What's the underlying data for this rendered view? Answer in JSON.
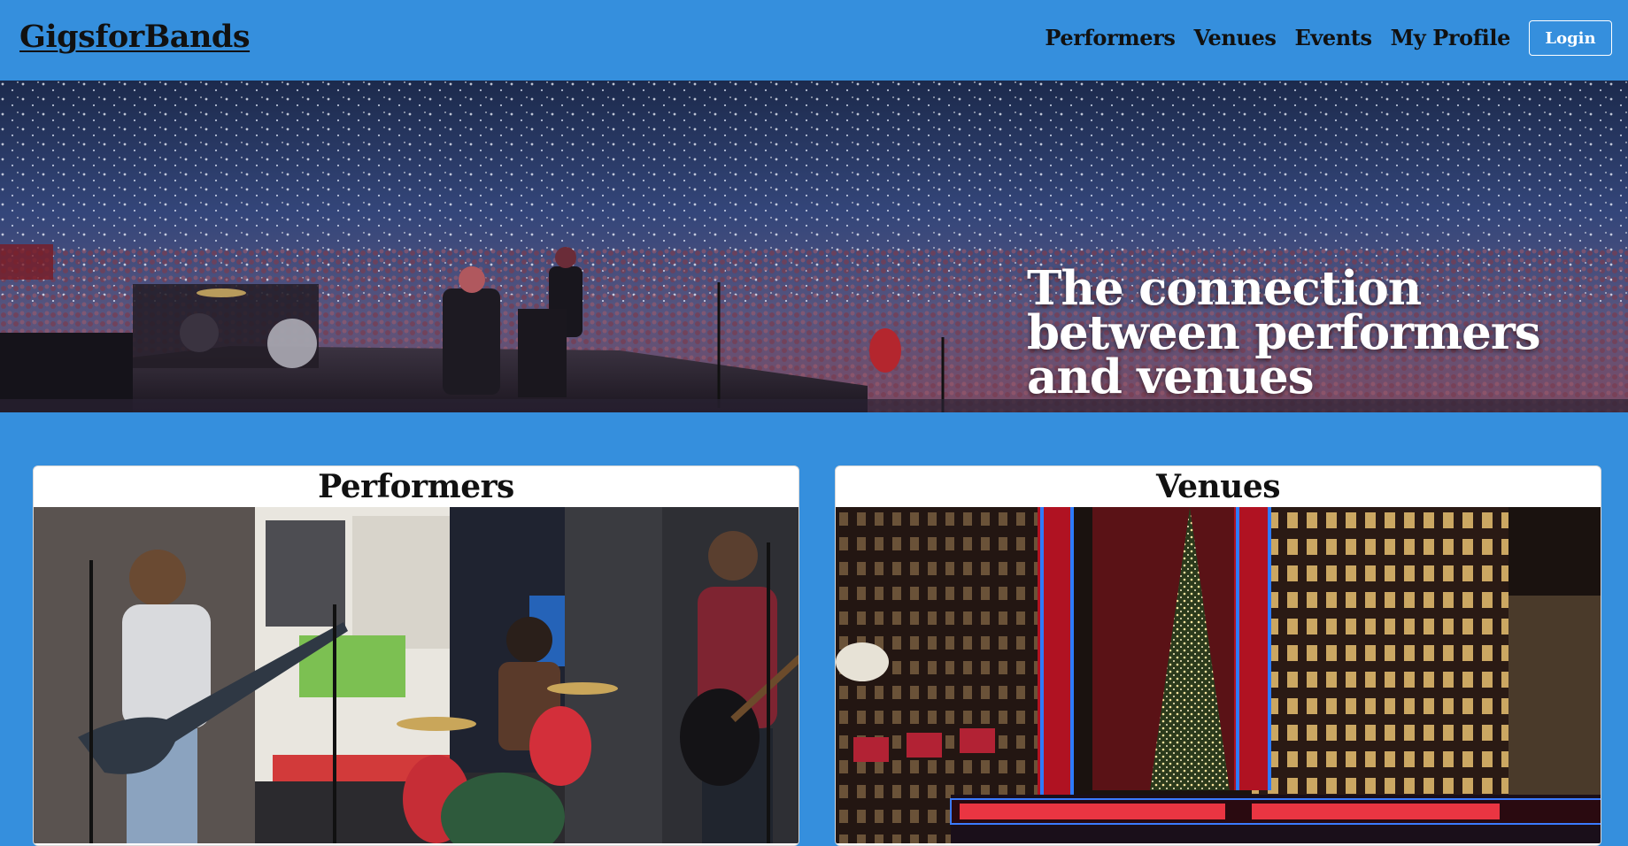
{
  "navbar": {
    "brand": "GigsforBands",
    "links": [
      "Performers",
      "Venues",
      "Events",
      "My Profile"
    ],
    "login_label": "Login"
  },
  "hero": {
    "headline": "The connection between performers and venues",
    "image": "concert-stage-crowd"
  },
  "cards": [
    {
      "title": "Performers",
      "image": "street-band-photo"
    },
    {
      "title": "Venues",
      "image": "radio-city-music-hall-photo"
    }
  ],
  "colors": {
    "background": "#358fdd",
    "text": "#111111",
    "white": "#ffffff"
  }
}
